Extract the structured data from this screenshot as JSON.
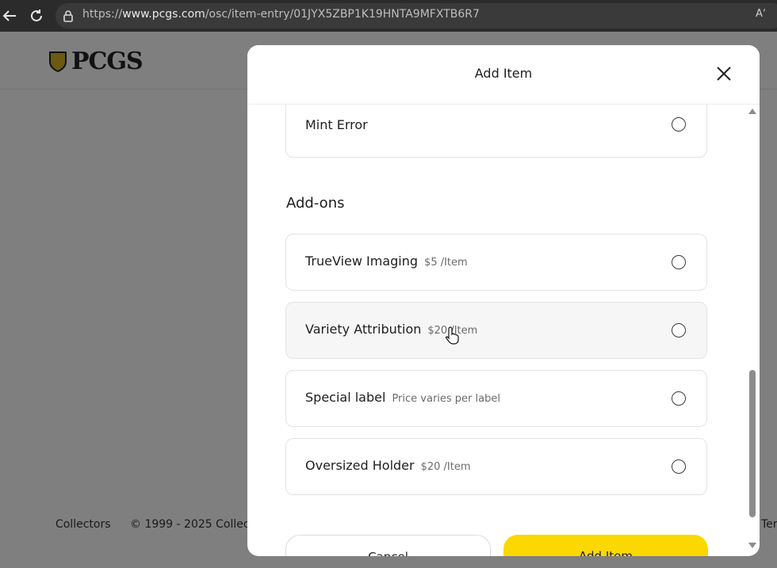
{
  "browser": {
    "url_prefix": "https://",
    "url_domain": "www.pcgs.com",
    "url_path": "/osc/item-entry/01JYX5ZBP1K19HNTA9MFXTB6R7",
    "read_aloud": "Aʼ"
  },
  "page": {
    "logo_text": "PCGS",
    "footer_left": "Collectors",
    "footer_copy": "© 1999 - 2025 Collect",
    "footer_right": "Ter"
  },
  "modal": {
    "title": "Add Item",
    "mint_error_label": "Mint Error",
    "addons_title": "Add-ons",
    "addons": [
      {
        "label": "TrueView Imaging",
        "price": "$5 /Item"
      },
      {
        "label": "Variety Attribution",
        "price": "$20 /Item"
      },
      {
        "label": "Special label",
        "price": "Price varies per label"
      },
      {
        "label": "Oversized Holder",
        "price": "$20 /Item"
      }
    ],
    "cancel_label": "Cancel",
    "add_label": "Add Item"
  },
  "colors": {
    "accent_yellow": "#fad800",
    "overlay_gray": "#7f7f7f"
  },
  "icons": [
    "back-arrow-icon",
    "refresh-icon",
    "lock-icon",
    "read-aloud-icon",
    "close-icon",
    "radio-icon",
    "hand-cursor-icon",
    "scroll-up-icon",
    "scroll-down-icon"
  ]
}
